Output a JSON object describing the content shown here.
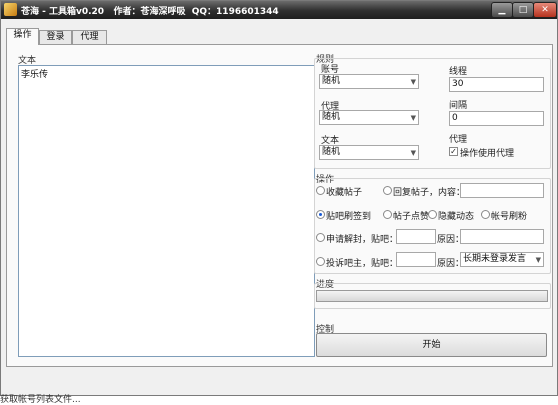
{
  "window": {
    "title": "苍海 - 工具箱v0.20   作者：苍海深呼吸  QQ：1196601344"
  },
  "titlebar_buttons": {
    "minimize": "▁",
    "maximize": "□",
    "close": "✕"
  },
  "tabs": [
    {
      "label": "操作"
    },
    {
      "label": "登录"
    },
    {
      "label": "代理"
    }
  ],
  "text_section": {
    "label": "文本",
    "content": "李乐传"
  },
  "rules": {
    "label": "规则",
    "account": {
      "label": "账号",
      "value": "随机"
    },
    "proxy": {
      "label": "代理",
      "value": "随机"
    },
    "text": {
      "label": "文本",
      "value": "随机"
    },
    "threads": {
      "label": "线程",
      "value": "30"
    },
    "interval": {
      "label": "间隔",
      "value": "0"
    },
    "proxy_option": {
      "label": "代理",
      "checkbox_label": "操作使用代理",
      "checked": true
    }
  },
  "operations": {
    "label": "操作",
    "favorite_post": "收藏帖子",
    "reply_post": "回复帖子，内容：",
    "tieba_signin": "贴吧刷签到",
    "post_like": "帖子点赞",
    "hide_activity": "隐藏动态",
    "account_fans": "帐号刷粉",
    "apply_unban": "申请解封，贴吧：",
    "reason1": "原因：",
    "complain_owner": "投诉吧主，贴吧：",
    "reason2": "原因：",
    "reason2_value": "长期未登录发言",
    "selected": "tieba_signin"
  },
  "progress": {
    "label": "进度",
    "value": 0
  },
  "control": {
    "label": "控制",
    "start_button": "开始"
  },
  "status": {
    "text": "获取帐号列表文件..."
  }
}
